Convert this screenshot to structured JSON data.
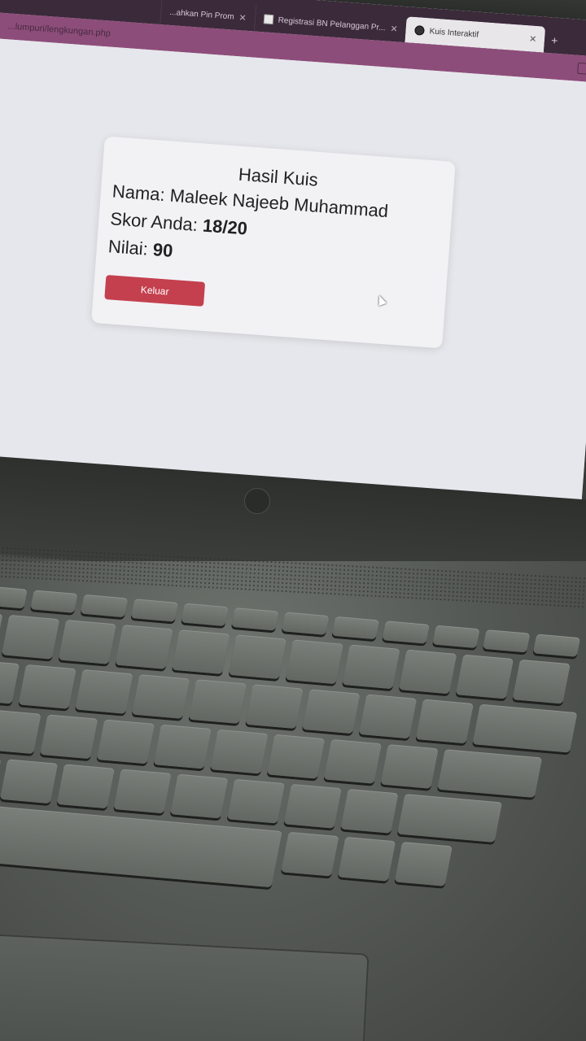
{
  "browser": {
    "tabs": [
      {
        "label": "...ahkan Pin Prom",
        "active": false
      },
      {
        "label": "Registrasi BN Pelanggan Pr...",
        "active": false
      },
      {
        "label": "Kuis Interaktif",
        "active": true
      }
    ],
    "url": "...lumpuri/lengkungan.php"
  },
  "card": {
    "title": "Hasil Kuis",
    "name_label": "Nama:",
    "name_value": "Maleek Najeeb Muhammad",
    "score_label": "Skor Anda:",
    "score_value": "18/20",
    "grade_label": "Nilai:",
    "grade_value": "90",
    "logout_label": "Keluar"
  },
  "colors": {
    "tab_bar": "#3b2a3a",
    "url_bar": "#8d4d7a",
    "page_bg": "#e6e7ec",
    "card_bg": "#f2f2f5",
    "logout_button": "#c4404e"
  }
}
